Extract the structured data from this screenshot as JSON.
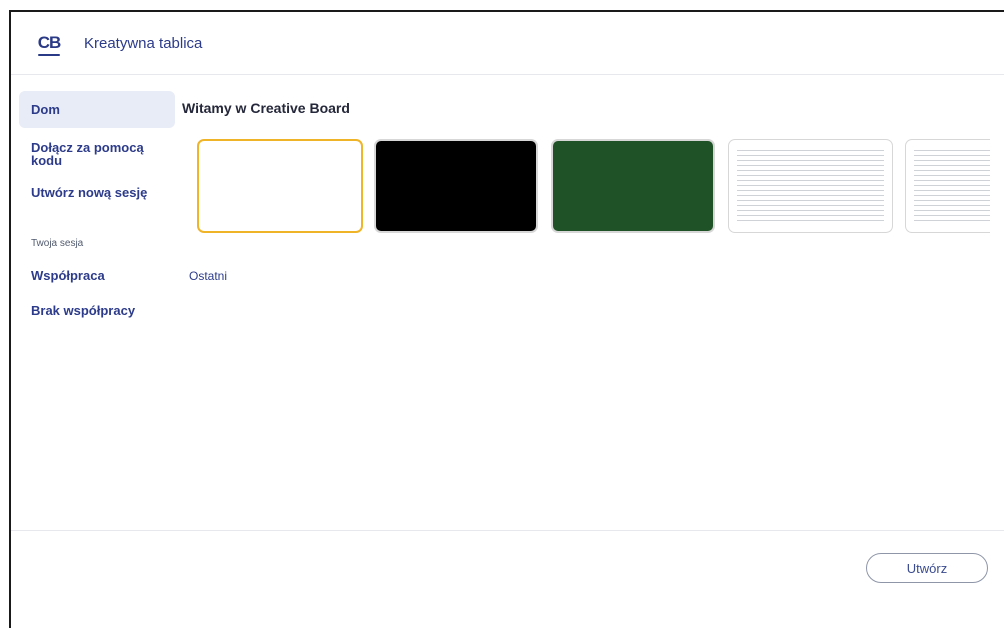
{
  "header": {
    "logo_text": "CB",
    "app_title": "Kreatywna tablica"
  },
  "sidebar": {
    "items": [
      {
        "label": "Dom"
      },
      {
        "label": "Dołącz za pomocą kodu"
      },
      {
        "label": "Utwórz nową sesję"
      }
    ],
    "section_label": "Twoja sesja",
    "session_items": [
      {
        "label": "Współpraca"
      },
      {
        "label": "Brak współpracy"
      }
    ]
  },
  "main": {
    "title": "Witamy w Creative Board",
    "templates": [
      {
        "name": "white",
        "color": "#ffffff",
        "selected": true
      },
      {
        "name": "black",
        "color": "#000000"
      },
      {
        "name": "green",
        "color": "#1f5226"
      },
      {
        "name": "lined",
        "color": "#ffffff"
      },
      {
        "name": "lined",
        "color": "#ffffff"
      }
    ],
    "recent_label": "Ostatni"
  },
  "footer": {
    "create_label": "Utwórz"
  },
  "colors": {
    "accent": "#2c3b8a",
    "selection": "#f0b429"
  }
}
